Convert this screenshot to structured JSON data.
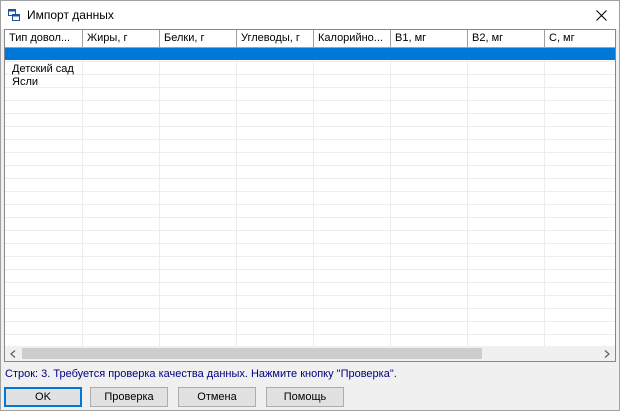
{
  "window": {
    "title": "Импорт данных"
  },
  "grid": {
    "columns": [
      "Тип довол...",
      "Жиры, г",
      "Белки, г",
      "Углеводы, г",
      "Калорийно...",
      "B1, мг",
      "B2, мг",
      "C, мг"
    ],
    "rows": [
      {
        "label": ""
      },
      {
        "label": "Детский сад"
      },
      {
        "label": "Ясли"
      }
    ]
  },
  "status": {
    "message": "Строк: 3. Требуется проверка качества данных. Нажмите кнопку \"Проверка\"."
  },
  "buttons": {
    "ok": "OK",
    "check": "Проверка",
    "cancel": "Отмена",
    "help": "Помощь"
  },
  "colors": {
    "selection": "#0078d7",
    "status_text": "#000080"
  }
}
